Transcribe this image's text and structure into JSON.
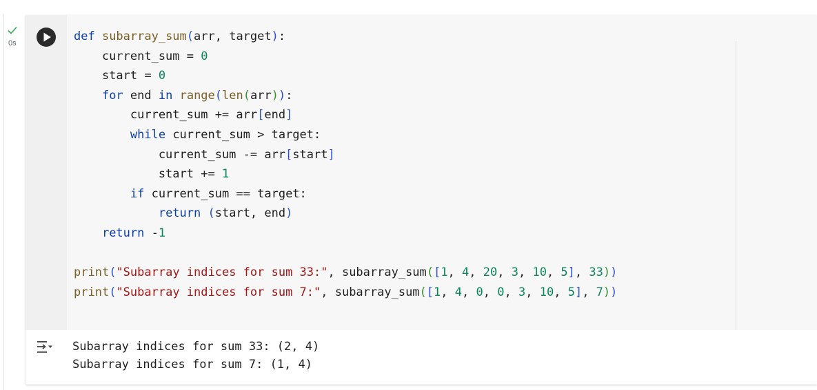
{
  "cell": {
    "exec_time": "0s",
    "run_icon": "play-icon",
    "status_icon": "checkmark-icon",
    "output_icon": "output-toggle-icon",
    "code_lines": [
      [
        {
          "t": "def ",
          "c": "kw"
        },
        {
          "t": "subarray_sum",
          "c": "fn"
        },
        {
          "t": "(",
          "c": "br1"
        },
        {
          "t": "arr, target",
          "c": ""
        },
        {
          "t": ")",
          "c": "br1"
        },
        {
          "t": ":",
          "c": ""
        }
      ],
      [
        {
          "t": "    current_sum = ",
          "c": ""
        },
        {
          "t": "0",
          "c": "num"
        }
      ],
      [
        {
          "t": "    start = ",
          "c": ""
        },
        {
          "t": "0",
          "c": "num"
        }
      ],
      [
        {
          "t": "    ",
          "c": ""
        },
        {
          "t": "for",
          "c": "kw"
        },
        {
          "t": " end ",
          "c": ""
        },
        {
          "t": "in",
          "c": "kw"
        },
        {
          "t": " ",
          "c": ""
        },
        {
          "t": "range",
          "c": "fn"
        },
        {
          "t": "(",
          "c": "br1"
        },
        {
          "t": "len",
          "c": "fn"
        },
        {
          "t": "(",
          "c": "br2"
        },
        {
          "t": "arr",
          "c": ""
        },
        {
          "t": ")",
          "c": "br2"
        },
        {
          "t": ")",
          "c": "br1"
        },
        {
          "t": ":",
          "c": ""
        }
      ],
      [
        {
          "t": "        current_sum += arr",
          "c": ""
        },
        {
          "t": "[",
          "c": "br1"
        },
        {
          "t": "end",
          "c": ""
        },
        {
          "t": "]",
          "c": "br1"
        }
      ],
      [
        {
          "t": "        ",
          "c": ""
        },
        {
          "t": "while",
          "c": "kw"
        },
        {
          "t": " current_sum > target:",
          "c": ""
        }
      ],
      [
        {
          "t": "            current_sum -= arr",
          "c": ""
        },
        {
          "t": "[",
          "c": "br1"
        },
        {
          "t": "start",
          "c": ""
        },
        {
          "t": "]",
          "c": "br1"
        }
      ],
      [
        {
          "t": "            start += ",
          "c": ""
        },
        {
          "t": "1",
          "c": "num"
        }
      ],
      [
        {
          "t": "        ",
          "c": ""
        },
        {
          "t": "if",
          "c": "kw"
        },
        {
          "t": " current_sum == target:",
          "c": ""
        }
      ],
      [
        {
          "t": "            ",
          "c": ""
        },
        {
          "t": "return",
          "c": "kw"
        },
        {
          "t": " ",
          "c": ""
        },
        {
          "t": "(",
          "c": "br1"
        },
        {
          "t": "start, end",
          "c": ""
        },
        {
          "t": ")",
          "c": "br1"
        }
      ],
      [
        {
          "t": "    ",
          "c": ""
        },
        {
          "t": "return",
          "c": "kw"
        },
        {
          "t": " -",
          "c": ""
        },
        {
          "t": "1",
          "c": "num"
        }
      ],
      [
        {
          "t": "",
          "c": ""
        }
      ],
      [
        {
          "t": "print",
          "c": "fn"
        },
        {
          "t": "(",
          "c": "br1"
        },
        {
          "t": "\"Subarray indices for sum 33:\"",
          "c": "str"
        },
        {
          "t": ", subarray_sum",
          "c": ""
        },
        {
          "t": "(",
          "c": "br2"
        },
        {
          "t": "[",
          "c": "br1"
        },
        {
          "t": "1",
          "c": "num"
        },
        {
          "t": ", ",
          "c": ""
        },
        {
          "t": "4",
          "c": "num"
        },
        {
          "t": ", ",
          "c": ""
        },
        {
          "t": "20",
          "c": "num"
        },
        {
          "t": ", ",
          "c": ""
        },
        {
          "t": "3",
          "c": "num"
        },
        {
          "t": ", ",
          "c": ""
        },
        {
          "t": "10",
          "c": "num"
        },
        {
          "t": ", ",
          "c": ""
        },
        {
          "t": "5",
          "c": "num"
        },
        {
          "t": "]",
          "c": "br1"
        },
        {
          "t": ", ",
          "c": ""
        },
        {
          "t": "33",
          "c": "num"
        },
        {
          "t": ")",
          "c": "br2"
        },
        {
          "t": ")",
          "c": "br1"
        }
      ],
      [
        {
          "t": "print",
          "c": "fn"
        },
        {
          "t": "(",
          "c": "br1"
        },
        {
          "t": "\"Subarray indices for sum 7:\"",
          "c": "str"
        },
        {
          "t": ", subarray_sum",
          "c": ""
        },
        {
          "t": "(",
          "c": "br2"
        },
        {
          "t": "[",
          "c": "br1"
        },
        {
          "t": "1",
          "c": "num"
        },
        {
          "t": ", ",
          "c": ""
        },
        {
          "t": "4",
          "c": "num"
        },
        {
          "t": ", ",
          "c": ""
        },
        {
          "t": "0",
          "c": "num"
        },
        {
          "t": ", ",
          "c": ""
        },
        {
          "t": "0",
          "c": "num"
        },
        {
          "t": ", ",
          "c": ""
        },
        {
          "t": "3",
          "c": "num"
        },
        {
          "t": ", ",
          "c": ""
        },
        {
          "t": "10",
          "c": "num"
        },
        {
          "t": ", ",
          "c": ""
        },
        {
          "t": "5",
          "c": "num"
        },
        {
          "t": "]",
          "c": "br1"
        },
        {
          "t": ", ",
          "c": ""
        },
        {
          "t": "7",
          "c": "num"
        },
        {
          "t": ")",
          "c": "br2"
        },
        {
          "t": ")",
          "c": "br1"
        }
      ]
    ],
    "output_lines": [
      "Subarray indices for sum 33: (2, 4)",
      "Subarray indices for sum 7: (1, 4)"
    ]
  },
  "colors": {
    "keyword": "#0b3fa8",
    "function": "#795e26",
    "string": "#a31515",
    "number": "#098658",
    "success_check": "#34a853"
  }
}
